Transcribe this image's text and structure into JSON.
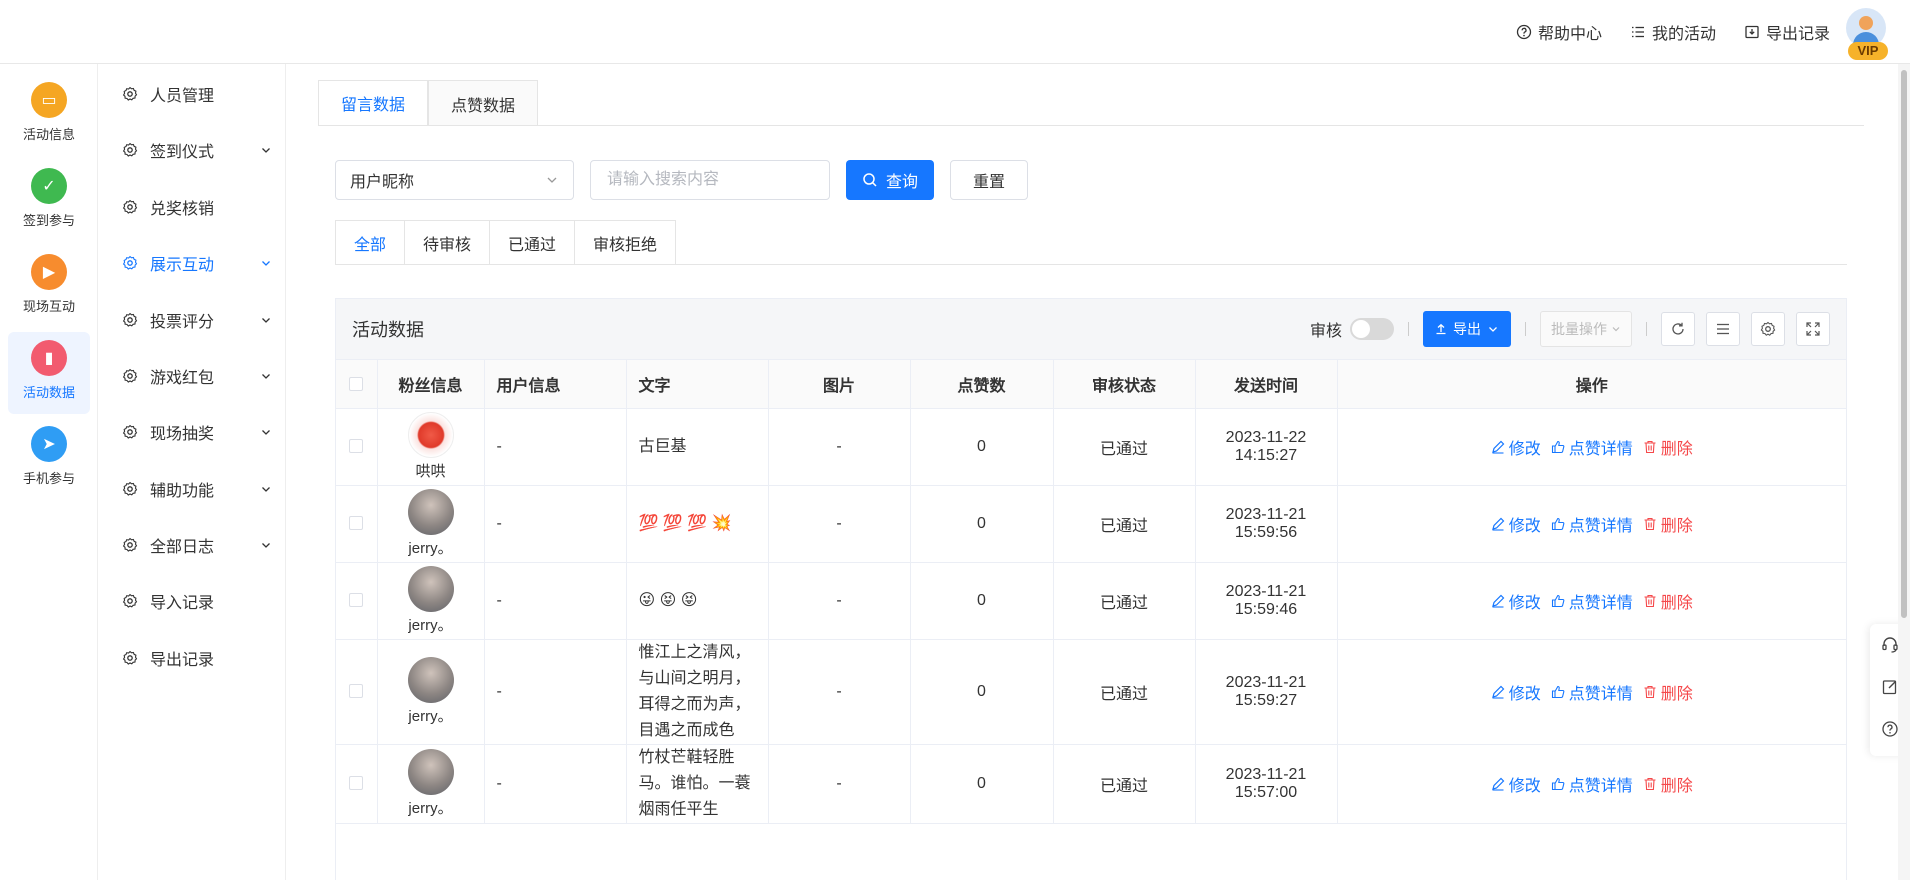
{
  "header": {
    "links": [
      {
        "label": "帮助中心"
      },
      {
        "label": "我的活动"
      },
      {
        "label": "导出记录"
      }
    ],
    "vip_label": "VIP"
  },
  "rail": [
    {
      "label": "活动信息",
      "color": "#f5a623"
    },
    {
      "label": "签到参与",
      "color": "#3fb950"
    },
    {
      "label": "现场互动",
      "color": "#f78c2e"
    },
    {
      "label": "活动数据",
      "color": "#f25b6f"
    },
    {
      "label": "手机参与",
      "color": "#2f9df4"
    }
  ],
  "submenu": [
    {
      "label": "人员管理",
      "has_chevron": false
    },
    {
      "label": "签到仪式",
      "has_chevron": true
    },
    {
      "label": "兑奖核销",
      "has_chevron": false
    },
    {
      "label": "展示互动",
      "has_chevron": true
    },
    {
      "label": "投票评分",
      "has_chevron": true
    },
    {
      "label": "游戏红包",
      "has_chevron": true
    },
    {
      "label": "现场抽奖",
      "has_chevron": true
    },
    {
      "label": "辅助功能",
      "has_chevron": true
    },
    {
      "label": "全部日志",
      "has_chevron": true
    },
    {
      "label": "导入记录",
      "has_chevron": false
    },
    {
      "label": "导出记录",
      "has_chevron": false
    }
  ],
  "top_tabs": [
    "留言数据",
    "点赞数据"
  ],
  "filter": {
    "select_value": "用户昵称",
    "search_placeholder": "请输入搜索内容",
    "query_label": "查询",
    "reset_label": "重置"
  },
  "status_tabs": [
    "全部",
    "待审核",
    "已通过",
    "审核拒绝"
  ],
  "table": {
    "title": "活动数据",
    "toggle_label": "审核",
    "export_label": "导出",
    "batch_label": "批量操作",
    "columns": [
      "粉丝信息",
      "用户信息",
      "文字",
      "图片",
      "点赞数",
      "审核状态",
      "发送时间",
      "操作"
    ],
    "rows": [
      {
        "name": "哄哄",
        "user": "-",
        "text": "古巨基",
        "image": "-",
        "likes": "0",
        "status": "已通过",
        "time": "2023-11-22 14:15:27"
      },
      {
        "name": "jerry。",
        "user": "-",
        "text": "💯 💯 💯 💥",
        "image": "-",
        "likes": "0",
        "status": "已通过",
        "time": "2023-11-21 15:59:56"
      },
      {
        "name": "jerry。",
        "user": "-",
        "text": "😜 😝 😝",
        "image": "-",
        "likes": "0",
        "status": "已通过",
        "time": "2023-11-21 15:59:46"
      },
      {
        "name": "jerry。",
        "user": "-",
        "text": "惟江上之清风，与山间之明月，耳得之而为声，目遇之而成色",
        "image": "-",
        "likes": "0",
        "status": "已通过",
        "time": "2023-11-21 15:59:27"
      },
      {
        "name": "jerry。",
        "user": "-",
        "text": "竹杖芒鞋轻胜马。谁怕。一蓑烟雨任平生",
        "image": "-",
        "likes": "0",
        "status": "已通过",
        "time": "2023-11-21 15:57:00"
      }
    ],
    "ops": {
      "edit": "修改",
      "like_detail": "点赞详情",
      "delete": "删除"
    }
  },
  "colors": {
    "primary": "#1677ff",
    "danger": "#f5484a"
  }
}
